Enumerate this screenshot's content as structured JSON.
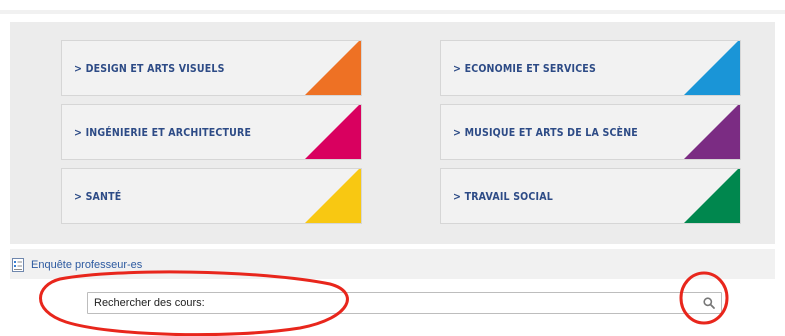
{
  "categories": [
    {
      "label": "> DESIGN ET ARTS VISUELS",
      "color": "#ee7124"
    },
    {
      "label": "> ECONOMIE ET SERVICES",
      "color": "#1a95d7"
    },
    {
      "label": "> INGÉNIERIE ET ARCHITECTURE",
      "color": "#d9005f"
    },
    {
      "label": "> MUSIQUE ET ARTS DE LA SCÈNE",
      "color": "#7b2c83"
    },
    {
      "label": "> SANTÉ",
      "color": "#f8c812"
    },
    {
      "label": "> TRAVAIL SOCIAL",
      "color": "#00874e"
    }
  ],
  "survey": {
    "label": "Enquête professeur-es",
    "icon": "checklist-document-icon"
  },
  "search": {
    "placeholder": "Rechercher des cours:",
    "button_icon": "search-icon"
  },
  "annotations": {
    "color": "#e8261c"
  }
}
